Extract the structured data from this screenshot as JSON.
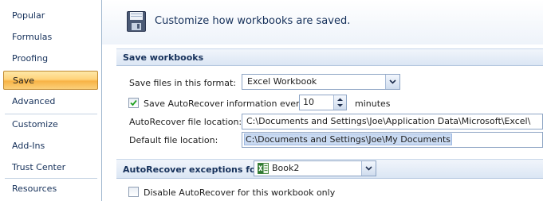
{
  "sidebar": {
    "items": [
      {
        "label": "Popular"
      },
      {
        "label": "Formulas"
      },
      {
        "label": "Proofing"
      },
      {
        "label": "Save"
      },
      {
        "label": "Advanced"
      },
      {
        "label": "Customize"
      },
      {
        "label": "Add-Ins"
      },
      {
        "label": "Trust Center"
      },
      {
        "label": "Resources"
      }
    ],
    "selected": "Save"
  },
  "header": {
    "icon": "floppy-disk-icon",
    "title": "Customize how workbooks are saved."
  },
  "save_workbooks": {
    "section_title": "Save workbooks",
    "format_label": "Save files in this format:",
    "format_value": "Excel Workbook",
    "autorecover_checkbox_label": "Save AutoRecover information every",
    "autorecover_checked": true,
    "autorecover_minutes": "10",
    "minutes_label": "minutes",
    "autorecover_location_label": "AutoRecover file location:",
    "autorecover_location_value": "C:\\Documents and Settings\\Joe\\Application Data\\Microsoft\\Excel\\",
    "default_location_label": "Default file location:",
    "default_location_value": "C:\\Documents and Settings\\Joe\\My Documents"
  },
  "exceptions": {
    "section_title": "AutoRecover exceptions for:",
    "workbook_value": "Book2",
    "workbook_icon": "excel-workbook-icon",
    "disable_label": "Disable AutoRecover for this workbook only",
    "disable_checked": false
  },
  "colors": {
    "accent": "#15305a",
    "selection": "#f8b345",
    "section_bar": "#dbe6f4"
  }
}
